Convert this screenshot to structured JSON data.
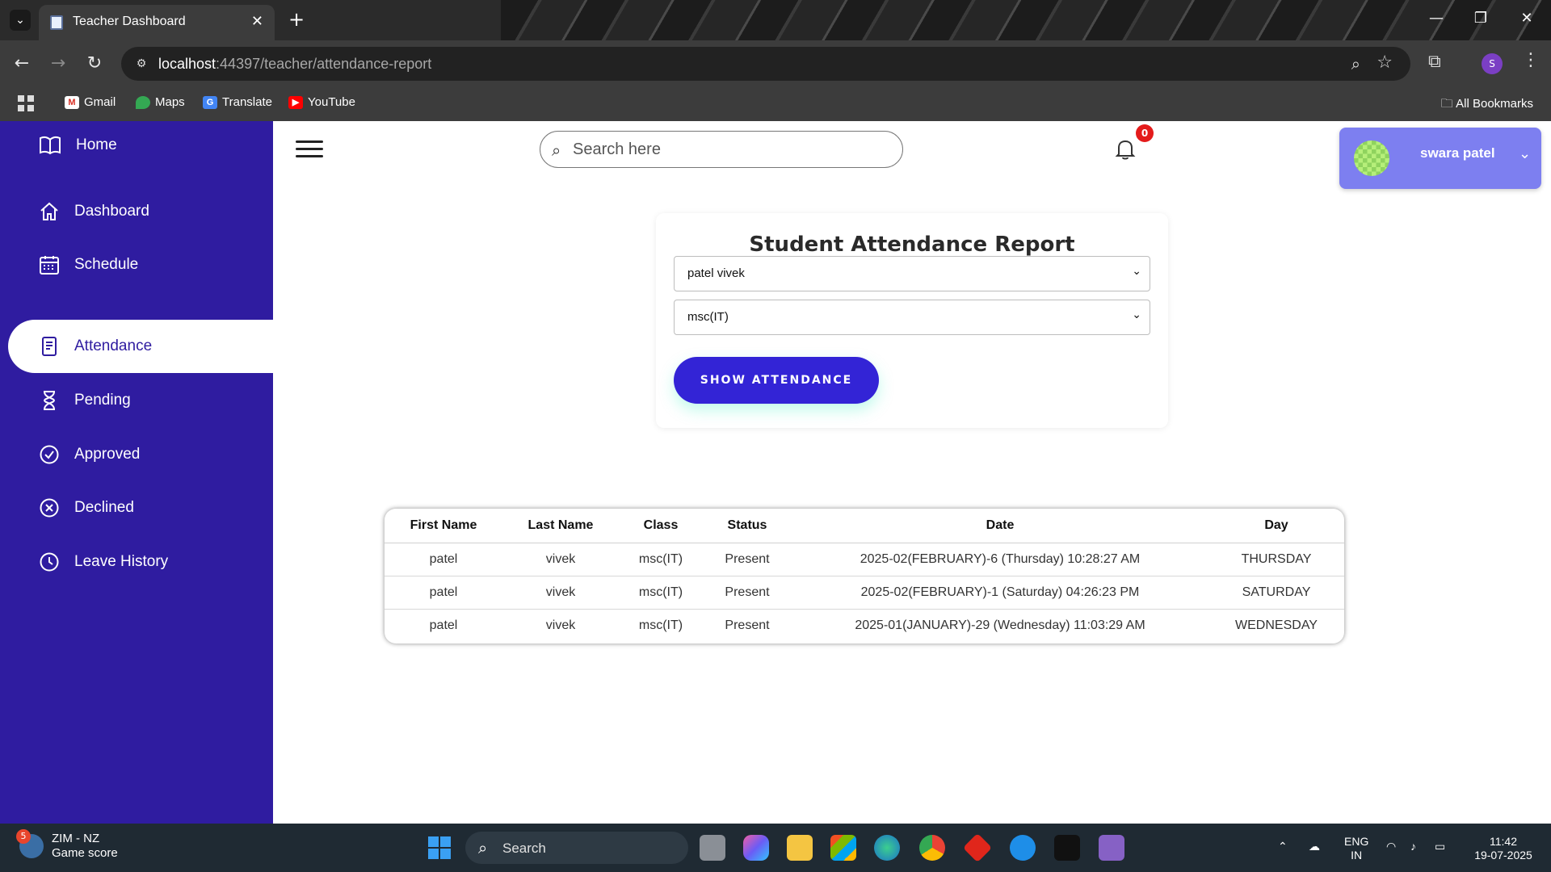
{
  "browser": {
    "tab_title": "Teacher Dashboard",
    "url_host": "localhost",
    "url_rest": ":44397/teacher/attendance-report",
    "bookmarks": [
      "Gmail",
      "Maps",
      "Translate",
      "YouTube"
    ],
    "all_bookmarks": "All Bookmarks",
    "profile_initial": "S"
  },
  "sidebar": {
    "home": "Home",
    "items": [
      {
        "label": "Dashboard",
        "icon": "home-icon"
      },
      {
        "label": "Schedule",
        "icon": "calendar-icon"
      },
      {
        "label": "Attendance",
        "icon": "clipboard-icon",
        "active": true
      },
      {
        "label": "Pending",
        "icon": "hourglass-icon"
      },
      {
        "label": "Approved",
        "icon": "check-circle-icon"
      },
      {
        "label": "Declined",
        "icon": "x-circle-icon"
      },
      {
        "label": "Leave History",
        "icon": "clock-icon"
      }
    ]
  },
  "header": {
    "search_placeholder": "Search here",
    "notification_count": "0",
    "user_name": "swara patel"
  },
  "report": {
    "title": "Student Attendance Report",
    "student_select": "patel vivek",
    "class_select": "msc(IT)",
    "button_label": "SHOW ATTENDANCE"
  },
  "table": {
    "headers": [
      "First Name",
      "Last Name",
      "Class",
      "Status",
      "Date",
      "Day"
    ],
    "rows": [
      [
        "patel",
        "vivek",
        "msc(IT)",
        "Present",
        "2025-02(FEBRUARY)-6 (Thursday) 10:28:27 AM",
        "THURSDAY"
      ],
      [
        "patel",
        "vivek",
        "msc(IT)",
        "Present",
        "2025-02(FEBRUARY)-1 (Saturday) 04:26:23 PM",
        "SATURDAY"
      ],
      [
        "patel",
        "vivek",
        "msc(IT)",
        "Present",
        "2025-01(JANUARY)-29 (Wednesday) 11:03:29 AM",
        "WEDNESDAY"
      ]
    ]
  },
  "taskbar": {
    "widget_badge": "5",
    "widget_title": "ZIM - NZ",
    "widget_sub": "Game score",
    "search_label": "Search",
    "lang_1": "ENG",
    "lang_2": "IN",
    "time": "11:42",
    "date": "19-07-2025"
  },
  "colors": {
    "sidebar": "#2f1ca0",
    "button": "#3324d6",
    "user_card": "#7d7ff0",
    "badge": "#e41b1b"
  }
}
